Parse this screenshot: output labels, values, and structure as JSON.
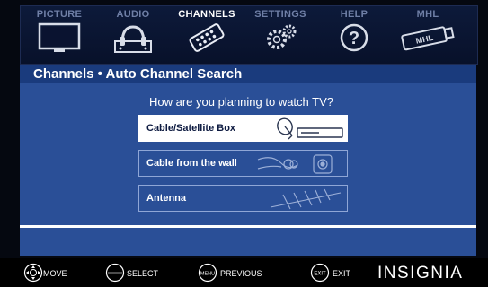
{
  "menu": {
    "tabs": [
      {
        "label": "PICTURE",
        "icon": "tv-icon",
        "active": false
      },
      {
        "label": "AUDIO",
        "icon": "headphones-icon",
        "active": false
      },
      {
        "label": "CHANNELS",
        "icon": "remote-icon",
        "active": true
      },
      {
        "label": "SETTINGS",
        "icon": "gears-icon",
        "active": false
      },
      {
        "label": "HELP",
        "icon": "question-icon",
        "active": false
      },
      {
        "label": "MHL",
        "icon": "mhl-icon",
        "active": false
      }
    ]
  },
  "panel": {
    "title": "Channels • Auto Channel Search",
    "question": "How are you planning to watch TV?",
    "options": [
      {
        "label": "Cable/Satellite Box",
        "icon": "cable-box-icon",
        "selected": true
      },
      {
        "label": "Cable from the wall",
        "icon": "wall-cable-icon",
        "selected": false
      },
      {
        "label": "Antenna",
        "icon": "antenna-icon",
        "selected": false
      }
    ]
  },
  "footer": {
    "move": "MOVE",
    "select": "SELECT",
    "previous": "PREVIOUS",
    "exit": "EXIT",
    "brand": "INSIGNIA",
    "buttons": {
      "select_inner": "OK ENTER",
      "menu_inner": "MENU",
      "exit_inner": "EXIT"
    }
  },
  "colors": {
    "panel": "#2a4f97",
    "title": "#1a3b7d",
    "menubar": "#0d1a3a",
    "selected": "#ffffff"
  }
}
